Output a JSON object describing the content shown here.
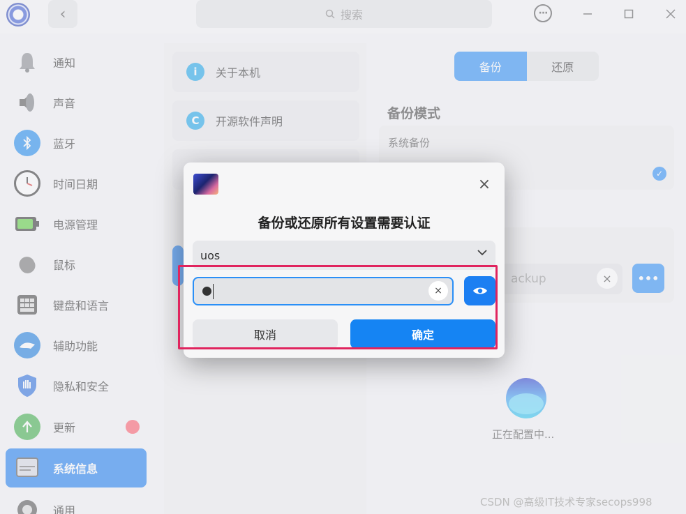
{
  "titlebar": {
    "search_placeholder": "搜索",
    "icons": [
      "app-logo",
      "back-arrow",
      "search-icon",
      "more-menu",
      "minimize",
      "maximize",
      "close"
    ]
  },
  "sidebar": {
    "items": [
      {
        "label": "通知",
        "icon": "bell-icon"
      },
      {
        "label": "声音",
        "icon": "speaker-icon"
      },
      {
        "label": "蓝牙",
        "icon": "bluetooth-icon"
      },
      {
        "label": "时间日期",
        "icon": "clock-icon"
      },
      {
        "label": "电源管理",
        "icon": "battery-icon"
      },
      {
        "label": "鼠标",
        "icon": "mouse-icon"
      },
      {
        "label": "键盘和语言",
        "icon": "keyboard-icon"
      },
      {
        "label": "辅助功能",
        "icon": "accessibility-icon"
      },
      {
        "label": "隐私和安全",
        "icon": "shield-icon"
      },
      {
        "label": "更新",
        "icon": "update-icon"
      },
      {
        "label": "系统信息",
        "icon": "uos-icon"
      },
      {
        "label": "通用",
        "icon": "gear-icon"
      }
    ],
    "active": "系统信息"
  },
  "middle": {
    "items": [
      {
        "label": "关于本机",
        "icon_glyph": "i"
      },
      {
        "label": "开源软件声明",
        "icon_glyph": "C"
      }
    ]
  },
  "right": {
    "tabs": [
      "备份",
      "还原"
    ],
    "active_tab": "备份",
    "section_title": "备份模式",
    "option_label": "系统备份",
    "path_text": "ackup",
    "status_text": "正在配置中..."
  },
  "dialog": {
    "title": "备份或还原所有设置需要认证",
    "user": "uos",
    "cancel_label": "取消",
    "confirm_label": "确定"
  },
  "watermark": "CSDN @高级IT技术专家secops998",
  "colors": {
    "accent": "#1c7ff2",
    "highlight_box": "#e0245e",
    "update_badge": "#ff5c6c"
  }
}
